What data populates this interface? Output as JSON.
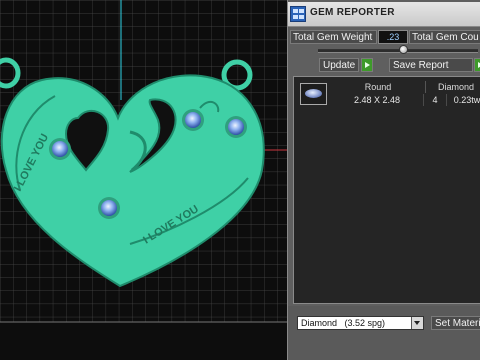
{
  "panel": {
    "title": "GEM REPORTER",
    "total_weight_label": "Total Gem Weight",
    "total_weight_value": ".23",
    "total_count_label": "Total Gem Cou",
    "update_label": "Update",
    "save_report_label": "Save Report",
    "columns": [
      "Round",
      "Diamond"
    ],
    "rows": [
      {
        "size": "2.48 X 2.48",
        "count": "4",
        "weight": "0.23tw"
      }
    ],
    "material_value": "Diamond   (3.52 spg)",
    "set_material_label": "Set Materi"
  },
  "viewport": {
    "model_text_1": "I LOVE YOU",
    "model_text_2": "I LOVE YOU",
    "model_color": "#3fd0a6",
    "gem_color": "#4a7ed8"
  }
}
